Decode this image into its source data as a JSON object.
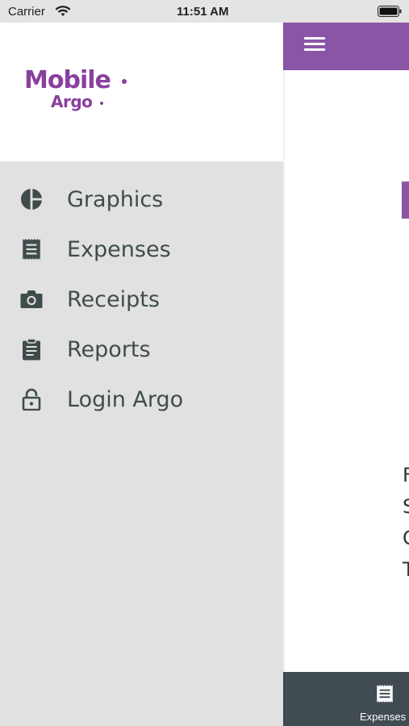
{
  "status_bar": {
    "carrier": "Carrier",
    "time": "11:51 AM"
  },
  "logo": {
    "line1": "Mobile",
    "line2": "Argo"
  },
  "menu": {
    "items": [
      {
        "label": "Graphics",
        "icon": "pie-chart-icon"
      },
      {
        "label": "Expenses",
        "icon": "receipt-icon"
      },
      {
        "label": "Receipts",
        "icon": "camera-icon"
      },
      {
        "label": "Reports",
        "icon": "clipboard-icon"
      },
      {
        "label": "Login Argo",
        "icon": "lock-icon"
      }
    ]
  },
  "content": {
    "letters": [
      "F",
      "S",
      "C",
      "T"
    ],
    "tab_bar": {
      "active_tab_label": "Expenses",
      "icon": "receipt-icon"
    }
  },
  "colors": {
    "brand_purple": "#8a3f9e",
    "app_bar": "#8b55a6",
    "drawer_bg": "#e1e1e1",
    "menu_text": "#404c4c",
    "tab_bar": "#404b52"
  }
}
